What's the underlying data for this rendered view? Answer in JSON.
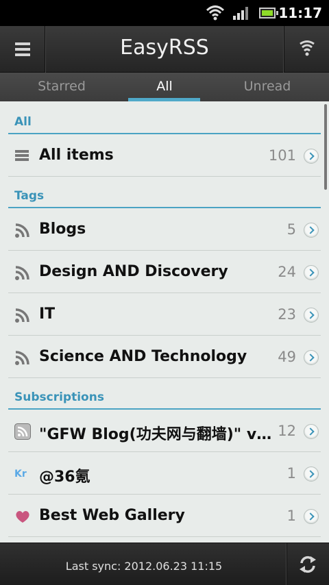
{
  "status_bar": {
    "time": "11:17"
  },
  "action_bar": {
    "title": "EasyRSS",
    "menu_icon": "menu-icon",
    "right_icon": "wifi-signal-icon"
  },
  "tabs": [
    {
      "label": "Starred",
      "active": false
    },
    {
      "label": "All",
      "active": true
    },
    {
      "label": "Unread",
      "active": false
    }
  ],
  "sections": {
    "all": {
      "title": "All",
      "items": [
        {
          "label": "All items",
          "count": "101",
          "icon": "list-icon"
        }
      ]
    },
    "tags": {
      "title": "Tags",
      "items": [
        {
          "label": "Blogs",
          "count": "5",
          "icon": "rss-icon"
        },
        {
          "label": "Design AND Discovery",
          "count": "24",
          "icon": "rss-icon"
        },
        {
          "label": "IT",
          "count": "23",
          "icon": "rss-icon"
        },
        {
          "label": "Science AND Technology",
          "count": "49",
          "icon": "rss-icon"
        }
      ]
    },
    "subscriptions": {
      "title": "Subscriptions",
      "items": [
        {
          "label": "\"GFW Blog(功夫网与翻墙)\" via ...",
          "count": "12",
          "icon": "feed-box-icon"
        },
        {
          "label": "@36氪",
          "count": "1",
          "icon": "kr-logo-icon",
          "icon_text": "Kr"
        },
        {
          "label": "Best Web Gallery",
          "count": "1",
          "icon": "heart-icon"
        }
      ]
    }
  },
  "bottom_bar": {
    "sync_text": "Last sync: 2012.06.23 11:15"
  },
  "colors": {
    "accent": "#4aa3c3",
    "background": "#e8ecea"
  }
}
